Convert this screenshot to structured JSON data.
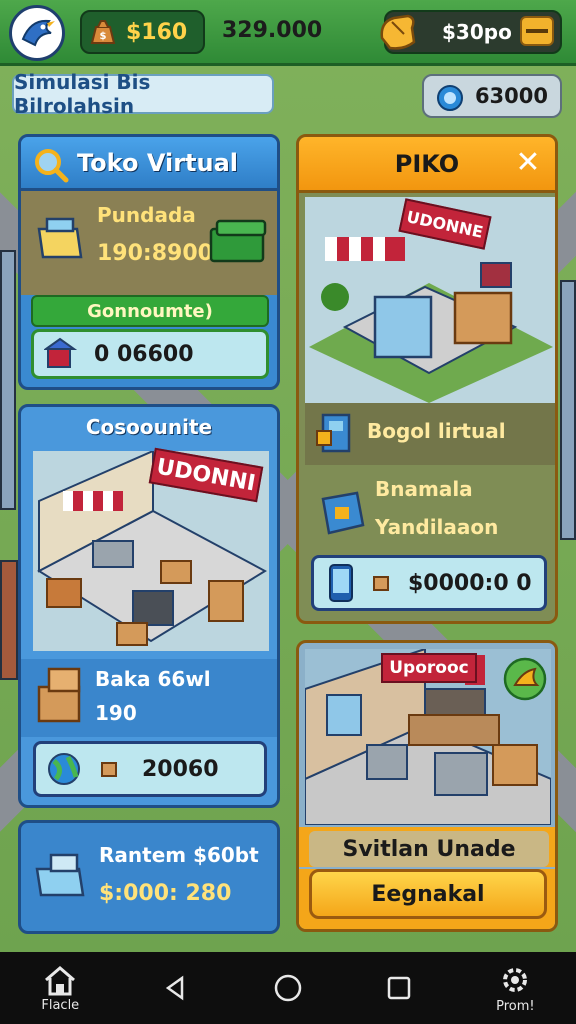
{
  "topbar": {
    "money": "$160",
    "coins": "329.000",
    "gems": "$30po"
  },
  "subbar": {
    "title": "Simulasi Bis Bilrolahsin",
    "gems_value": "63000"
  },
  "toko_panel": {
    "title": "Toko Virtual",
    "item_name": "Pundada",
    "item_value": "190:8900",
    "strip_label": "Gonnoumte)",
    "box_value": "0  06600"
  },
  "store_panel": {
    "title": "Cosoounite",
    "sign": "UDONNI",
    "item_name": "Baka 66wl",
    "item_value": "190",
    "box_value": "20060"
  },
  "rent_panel": {
    "line1": "Rantem $60bt",
    "line2": "$:000: 280"
  },
  "right_panel": {
    "title": "PIKO",
    "sign": "UDONNE",
    "row1": "Bogol lirtual",
    "row2_title": "Bnamala",
    "row2_sub": "Yandilaaon",
    "box_value": "$0000:0 0"
  },
  "upgrade_panel": {
    "sign": "Uporooc",
    "label": "Svitlan Unade",
    "button": "Eegnakal"
  },
  "navbar": {
    "home_label": "Flacle",
    "settings_label": "Prom!"
  },
  "colors": {
    "topbar": "#3a9a40",
    "panel_blue": "#3a8ad1",
    "panel_orange": "#f2960f",
    "accent_yellow": "#ffd34a"
  },
  "icons": [
    "bird-avatar-icon",
    "money-bag-icon",
    "hand-coin-icon",
    "menu-icon",
    "gem-icon",
    "magnifier-icon",
    "close-icon",
    "phone-icon",
    "box-icon",
    "home-icon",
    "back-icon",
    "circle-home-icon",
    "recents-icon",
    "gear-icon"
  ]
}
